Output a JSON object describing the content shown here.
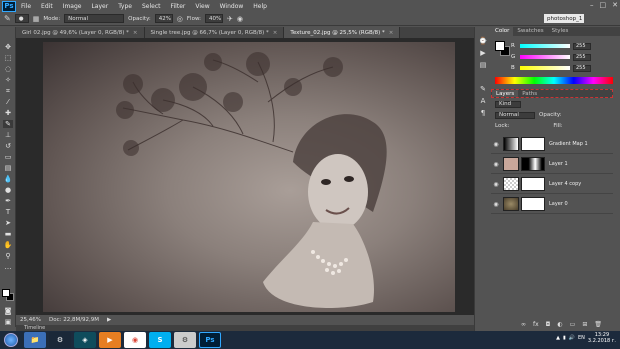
{
  "app": {
    "logo": "Ps"
  },
  "menu": [
    "File",
    "Edit",
    "Image",
    "Layer",
    "Type",
    "Select",
    "Filter",
    "View",
    "Window",
    "Help"
  ],
  "options": {
    "mode_label": "Mode:",
    "mode_value": "Normal",
    "opacity_label": "Opacity:",
    "opacity_value": "42%",
    "flow_label": "Flow:",
    "flow_value": "40%"
  },
  "workspace": "photoshop_1",
  "tabs": [
    {
      "label": "Girl 02.jpg @ 49,6% (Layer 0, RGB/8) *"
    },
    {
      "label": "Single tree.jpg @ 66,7% (Layer 0, RGB/8) *"
    },
    {
      "label": "Texture_02.jpg @ 25,5% (RGB/8) *"
    }
  ],
  "status": {
    "zoom": "25,46%",
    "doc": "Doc: 22,8M/92,9M"
  },
  "timeline": "Timeline",
  "color_panel": {
    "tabs": [
      "Color",
      "Swatches",
      "Styles"
    ],
    "r": "255",
    "g": "255",
    "b": "255"
  },
  "layers_panel": {
    "tabs": [
      "Layers",
      "Paths"
    ],
    "kind": "Kind",
    "blend": "Normal",
    "opacity_label": "Opacity:",
    "lock_label": "Lock:",
    "fill_label": "Fill:",
    "layers": [
      {
        "name": "Gradient Map 1"
      },
      {
        "name": "Layer 1"
      },
      {
        "name": "Layer 4 copy"
      },
      {
        "name": "Layer 0"
      }
    ]
  },
  "taskbar": {
    "apps": [
      "steam-icon",
      "xsplit-icon",
      "media-player-icon",
      "chrome-icon",
      "skype-icon",
      "settings-icon",
      "photoshop-icon"
    ],
    "lang": "EN",
    "time": "13:29",
    "date": "3.2.2018 г."
  }
}
